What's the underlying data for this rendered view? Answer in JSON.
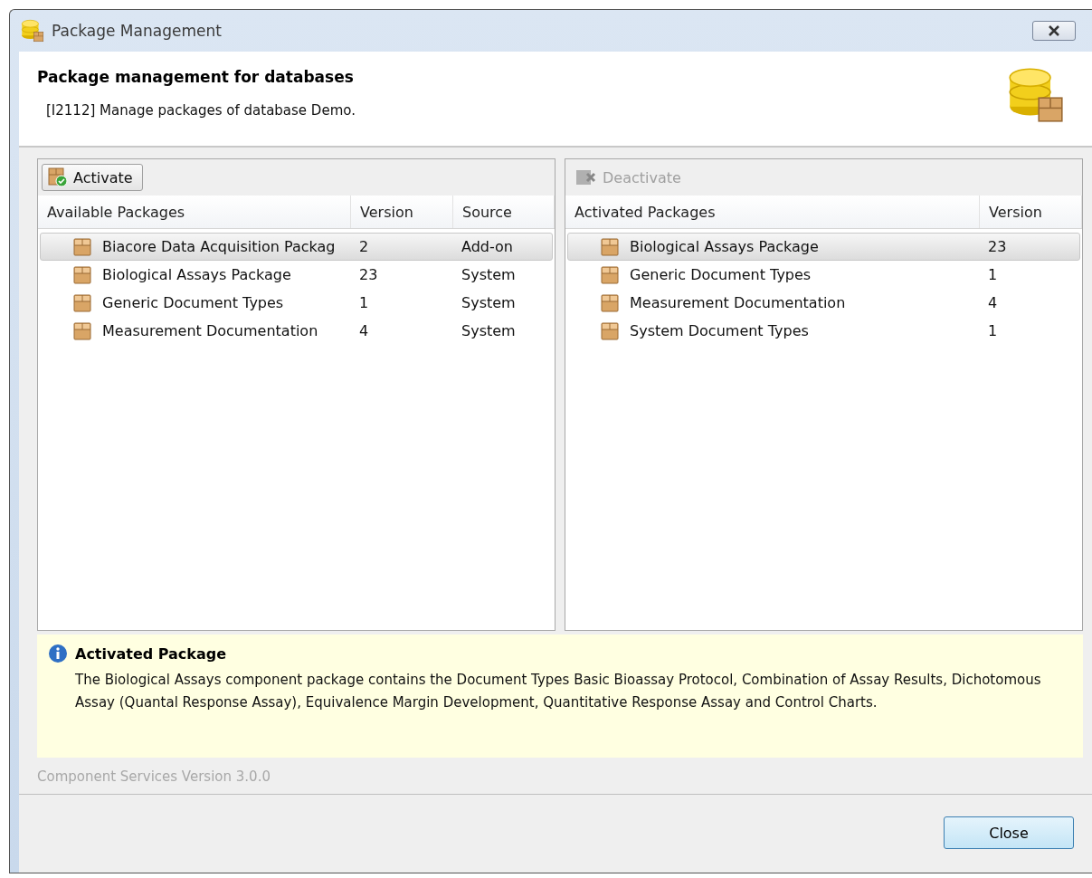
{
  "window": {
    "title": "Package Management"
  },
  "header": {
    "title": "Package management for databases",
    "message": "[I2112] Manage packages of database Demo."
  },
  "panels": [
    {
      "button": {
        "label": "Activate",
        "kind": "activate",
        "disabled": false
      },
      "columns": [
        "Available Packages",
        "Version",
        "Source"
      ],
      "rows": [
        {
          "cells": [
            "Biacore Data Acquisition Packag",
            "2",
            "Add-on"
          ],
          "selected": true
        },
        {
          "cells": [
            "Biological Assays Package",
            "23",
            "System"
          ],
          "selected": false
        },
        {
          "cells": [
            "Generic Document Types",
            "1",
            "System"
          ],
          "selected": false
        },
        {
          "cells": [
            "Measurement Documentation",
            "4",
            "System"
          ],
          "selected": false
        }
      ]
    },
    {
      "button": {
        "label": "Deactivate",
        "kind": "deactivate",
        "disabled": true
      },
      "columns": [
        "Activated Packages",
        "Version"
      ],
      "rows": [
        {
          "cells": [
            "Biological Assays Package",
            "23"
          ],
          "selected": true
        },
        {
          "cells": [
            "Generic Document Types",
            "1"
          ],
          "selected": false
        },
        {
          "cells": [
            "Measurement Documentation",
            "4"
          ],
          "selected": false
        },
        {
          "cells": [
            "System Document Types",
            "1"
          ],
          "selected": false
        }
      ]
    }
  ],
  "info": {
    "title": "Activated Package",
    "text": "The Biological Assays component package contains the Document Types Basic Bioassay Protocol, Combination of Assay Results, Dichotomous Assay (Quantal Response Assay), Equivalence Margin Development, Quantitative Response Assay and Control Charts."
  },
  "version_text": "Component Services Version 3.0.0",
  "buttons": [
    {
      "label": "Close"
    }
  ]
}
